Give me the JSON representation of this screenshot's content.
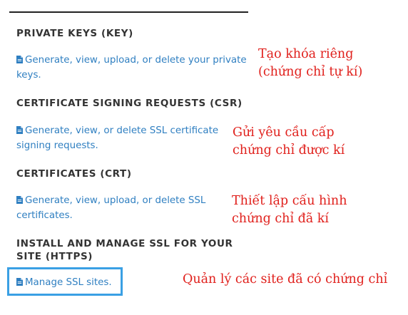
{
  "sections": {
    "private_keys": {
      "heading": "PRIVATE KEYS (KEY)",
      "link_line1": "Generate, view, upload, or delete your private",
      "link_line2": "keys.",
      "note_line1": "Tạo khóa riêng",
      "note_line2": "(chứng chỉ tự kí)"
    },
    "csr": {
      "heading": "CERTIFICATE SIGNING REQUESTS (CSR)",
      "link_line1": "Generate, view, or delete SSL certificate",
      "link_line2": "signing requests.",
      "note_line1": "Gửi yêu cầu cấp",
      "note_line2": "chứng chỉ được kí"
    },
    "certificates": {
      "heading": "CERTIFICATES (CRT)",
      "link_line1": "Generate, view, upload, or delete SSL",
      "link_line2": "certificates.",
      "note_line1": "Thiết lập cấu hình",
      "note_line2": "chứng chỉ đã kí"
    },
    "install": {
      "heading_line1": "INSTALL AND MANAGE SSL FOR YOUR",
      "heading_line2": "SITE (HTTPS)",
      "link_line1": "Manage SSL sites.",
      "note_line1": "Quản lý các site đã có chứng chỉ"
    }
  },
  "icons": {
    "link_icon": "document-icon"
  },
  "colors": {
    "heading": "#333333",
    "link": "#2f7fc1",
    "annotation": "#e0201c",
    "highlight_border": "#3aa0e4",
    "rule": "#222222"
  }
}
